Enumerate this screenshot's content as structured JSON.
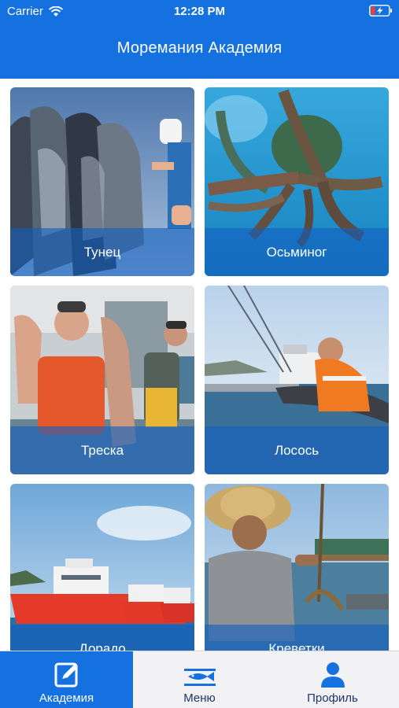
{
  "status_bar": {
    "carrier": "Carrier",
    "time": "12:28 PM"
  },
  "header": {
    "title": "Моремания Академия"
  },
  "cards": [
    {
      "label": "Тунец",
      "image": "tuna-catch-photo"
    },
    {
      "label": "Осьминог",
      "image": "octopus-underwater-photo"
    },
    {
      "label": "Треска",
      "image": "cod-fishermen-photo"
    },
    {
      "label": "Лосось",
      "image": "salmon-farm-photo"
    },
    {
      "label": "Дорадо",
      "image": "red-fishing-boats-photo"
    },
    {
      "label": "Креветки",
      "image": "shrimp-fisherman-photo"
    }
  ],
  "tabs": [
    {
      "label": "Академия",
      "icon": "edit-note-icon",
      "active": true
    },
    {
      "label": "Меню",
      "icon": "fish-menu-icon",
      "active": false
    },
    {
      "label": "Профиль",
      "icon": "person-icon",
      "active": false
    }
  ],
  "colors": {
    "accent": "#1570e0",
    "tab_inactive_text": "#1e3566",
    "tabbar_bg": "#f2f2f4"
  }
}
